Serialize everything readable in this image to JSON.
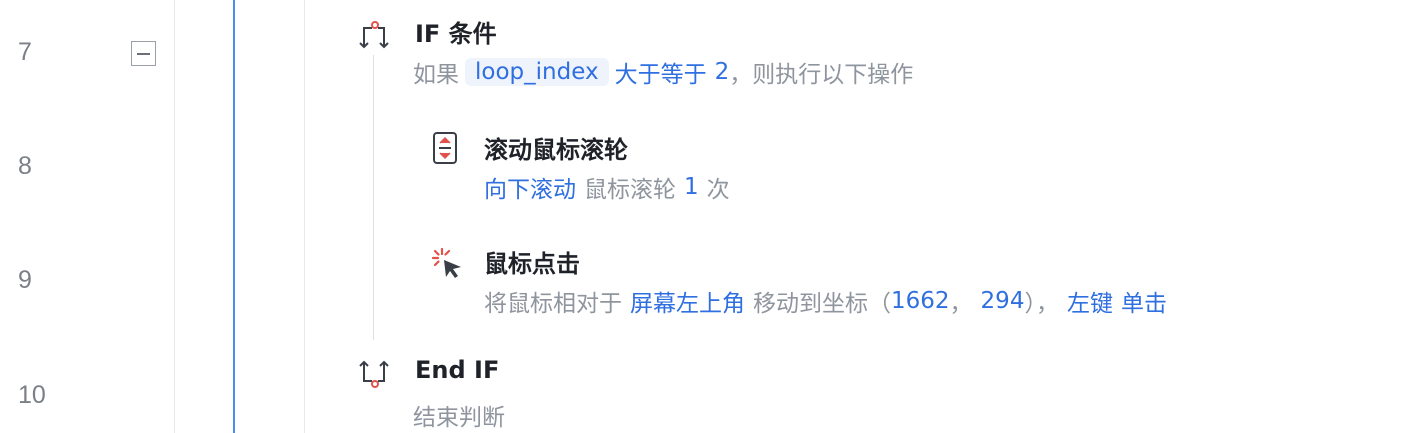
{
  "line_numbers": [
    "7",
    "8",
    "9",
    "10"
  ],
  "steps": {
    "if": {
      "title": "IF 条件",
      "prefix": "如果",
      "variable": "loop_index",
      "operator": "大于等于",
      "value": "2",
      "comma": "，",
      "suffix": "则执行以下操作",
      "icon": "if-branch-icon"
    },
    "scroll": {
      "title": "滚动鼠标滚轮",
      "direction": "向下滚动",
      "middle": "鼠标滚轮",
      "count": "1",
      "unit": "次",
      "icon": "scroll-wheel-icon"
    },
    "click": {
      "title": "鼠标点击",
      "prefix": "将鼠标相对于",
      "reference": "屏幕左上角",
      "middle": "移动到坐标",
      "open_paren": "（",
      "x": "1662",
      "sep": "，",
      "y": "294",
      "close_paren": "），",
      "button": "左键",
      "action": "单击",
      "icon": "mouse-click-icon"
    },
    "endif": {
      "title": "End IF",
      "desc": "结束判断",
      "icon": "end-if-icon"
    }
  },
  "colors": {
    "accent": "#2f6fe0",
    "rail": "#4c8bf5",
    "muted": "#8f959e",
    "icon_red": "#e0534a"
  }
}
